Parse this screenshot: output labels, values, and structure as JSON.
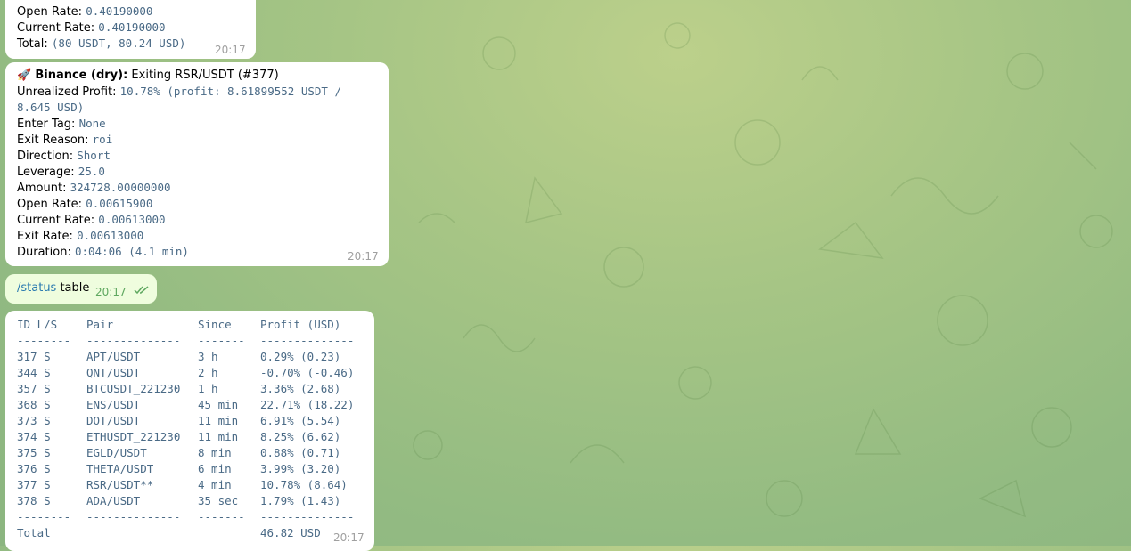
{
  "message1": {
    "lines": [
      {
        "label": "Open Rate:",
        "value": "0.40190000"
      },
      {
        "label": "Current Rate:",
        "value": "0.40190000"
      },
      {
        "label": "Total:",
        "value": "(80 USDT, 80.24 USD)"
      }
    ],
    "time": "20:17"
  },
  "message2": {
    "title_emoji": "🚀",
    "title_bold": "Binance (dry):",
    "title_rest": " Exiting RSR/USDT (#377)",
    "lines": [
      {
        "label": "Unrealized Profit:",
        "value": "10.78% (profit: 8.61899552 USDT /"
      },
      {
        "label": "",
        "value": "8.645 USD)"
      },
      {
        "label": "Enter Tag:",
        "value": "None"
      },
      {
        "label": "Exit Reason:",
        "value": "roi"
      },
      {
        "label": "Direction:",
        "value": "Short"
      },
      {
        "label": "Leverage:",
        "value": "25.0"
      },
      {
        "label": "Amount:",
        "value": "324728.00000000"
      },
      {
        "label": "Open Rate:",
        "value": "0.00615900"
      },
      {
        "label": "Current Rate:",
        "value": "0.00613000"
      },
      {
        "label": "Exit Rate:",
        "value": "0.00613000"
      },
      {
        "label": "Duration:",
        "value": "0:04:06 (4.1 min)"
      }
    ],
    "time": "20:17"
  },
  "message3": {
    "command": "/status",
    "arg": " table",
    "time": "20:17"
  },
  "message4": {
    "headers": [
      "ID L/S",
      "Pair",
      "Since",
      "Profit (USD)"
    ],
    "separator": [
      "--------",
      "--------------",
      "-------",
      "--------------"
    ],
    "rows": [
      [
        "317 S",
        "APT/USDT",
        "3 h",
        "0.29% (0.23)"
      ],
      [
        "344 S",
        "QNT/USDT",
        "2 h",
        "-0.70% (-0.46)"
      ],
      [
        "357 S",
        "BTCUSDT_221230",
        "1 h",
        "3.36% (2.68)"
      ],
      [
        "368 S",
        "ENS/USDT",
        "45 min",
        "22.71% (18.22)"
      ],
      [
        "373 S",
        "DOT/USDT",
        "11 min",
        "6.91% (5.54)"
      ],
      [
        "374 S",
        "ETHUSDT_221230",
        "11 min",
        "8.25% (6.62)"
      ],
      [
        "375 S",
        "EGLD/USDT",
        "8 min",
        "0.88% (0.71)"
      ],
      [
        "376 S",
        "THETA/USDT",
        "6 min",
        "3.99% (3.20)"
      ],
      [
        "377 S",
        "RSR/USDT**",
        "4 min",
        "10.78% (8.64)"
      ],
      [
        "378 S",
        "ADA/USDT",
        "35 sec",
        "1.79% (1.43)"
      ]
    ],
    "total_label": "Total",
    "total_value": "46.82 USD",
    "time": "20:17"
  }
}
